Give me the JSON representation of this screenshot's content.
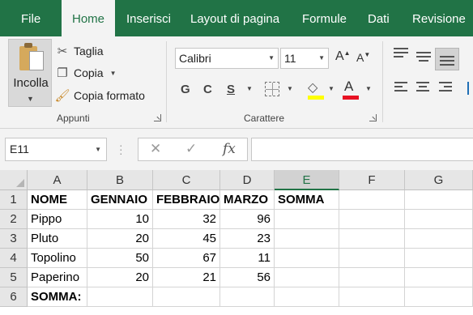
{
  "ribbon_tabs": [
    {
      "label": "File",
      "active": false
    },
    {
      "label": "Home",
      "active": true
    },
    {
      "label": "Inserisci",
      "active": false
    },
    {
      "label": "Layout di pagina",
      "active": false
    },
    {
      "label": "Formule",
      "active": false
    },
    {
      "label": "Dati",
      "active": false
    },
    {
      "label": "Revisione",
      "active": false
    }
  ],
  "clipboard": {
    "paste_label": "Incolla",
    "cut_label": "Taglia",
    "copy_label": "Copia",
    "format_painter_label": "Copia formato",
    "group_label": "Appunti"
  },
  "font": {
    "family": "Calibri",
    "size": "11",
    "grow_glyph": "A",
    "shrink_glyph": "A",
    "bold_glyph": "G",
    "italic_glyph": "C",
    "underline_glyph": "S",
    "group_label": "Carattere"
  },
  "formula_bar": {
    "name_box": "E11",
    "fx_glyph": "fx",
    "value": ""
  },
  "colors": {
    "brand_green": "#217346",
    "highlight_yellow": "#ffff00",
    "font_red": "#e81123"
  },
  "sheet": {
    "columns": [
      "A",
      "B",
      "C",
      "D",
      "E",
      "F",
      "G"
    ],
    "selected_column": "E",
    "rows": [
      "1",
      "2",
      "3",
      "4",
      "5",
      "6"
    ],
    "cells": [
      [
        "NOME",
        "GENNAIO",
        "FEBBRAIO",
        "MARZO",
        "SOMMA",
        "",
        ""
      ],
      [
        "Pippo",
        "10",
        "32",
        "96",
        "",
        "",
        ""
      ],
      [
        "Pluto",
        "20",
        "45",
        "23",
        "",
        "",
        ""
      ],
      [
        "Topolino",
        "50",
        "67",
        "11",
        "",
        "",
        ""
      ],
      [
        "Paperino",
        "20",
        "21",
        "56",
        "",
        "",
        ""
      ],
      [
        "SOMMA:",
        "",
        "",
        "",
        "",
        "",
        ""
      ]
    ]
  }
}
